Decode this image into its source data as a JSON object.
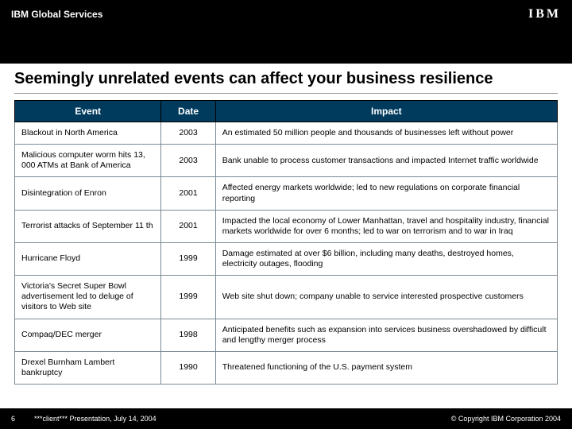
{
  "header": {
    "brand": "IBM Global Services",
    "logo": "IBM"
  },
  "title": "Seemingly unrelated events can affect your business resilience",
  "table": {
    "headers": {
      "event": "Event",
      "date": "Date",
      "impact": "Impact"
    },
    "rows": [
      {
        "event": "Blackout in North America",
        "date": "2003",
        "impact": "An estimated 50 million people and thousands of businesses left without power"
      },
      {
        "event": "Malicious computer worm hits 13, 000 ATMs at Bank of America",
        "date": "2003",
        "impact": "Bank unable to process customer transactions and impacted Internet traffic worldwide"
      },
      {
        "event": "Disintegration of Enron",
        "date": "2001",
        "impact": "Affected energy markets worldwide; led to new regulations on corporate financial reporting"
      },
      {
        "event": "Terrorist attacks of September 11 th",
        "date": "2001",
        "impact": "Impacted the local economy of Lower Manhattan, travel and hospitality industry, financial markets worldwide for over 6 months; led to war on terrorism and to war in Iraq"
      },
      {
        "event": "Hurricane Floyd",
        "date": "1999",
        "impact": "Damage estimated at over $6 billion, including many deaths, destroyed homes, electricity outages, flooding"
      },
      {
        "event": "Victoria's Secret Super Bowl advertisement led to deluge of visitors to Web site",
        "date": "1999",
        "impact": "Web site shut down; company unable to service interested prospective customers"
      },
      {
        "event": "Compaq/DEC merger",
        "date": "1998",
        "impact": "Anticipated benefits such as expansion into services business overshadowed by difficult and lengthy merger process"
      },
      {
        "event": "Drexel Burnham Lambert bankruptcy",
        "date": "1990",
        "impact": "Threatened functioning of the U.S. payment system"
      }
    ]
  },
  "footer": {
    "pagenum": "6",
    "presentation": "***client*** Presentation, July 14, 2004",
    "copyright": "© Copyright IBM Corporation 2004"
  }
}
